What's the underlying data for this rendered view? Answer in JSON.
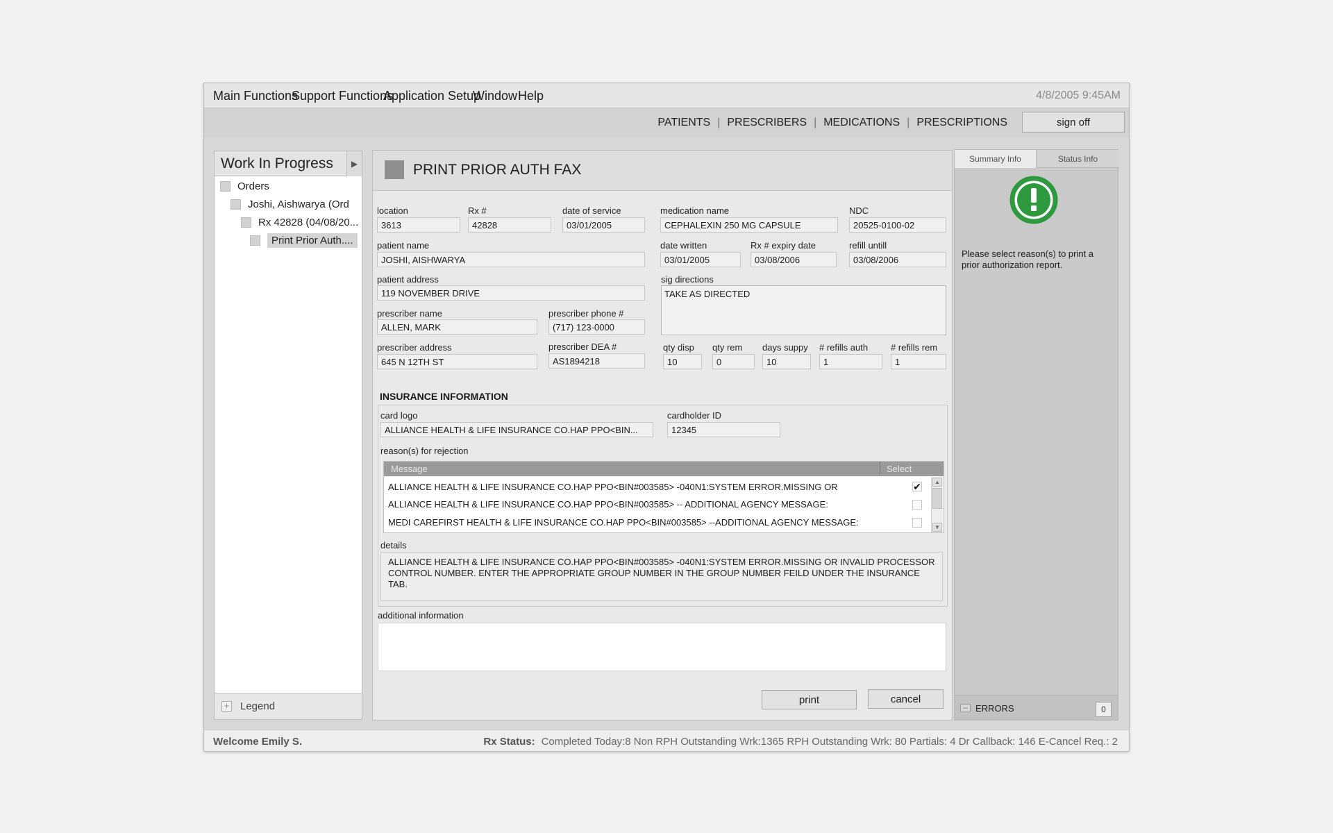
{
  "menubar": {
    "items": [
      "Main Functions",
      "Support Functions",
      "Application Setup",
      "Window",
      "Help"
    ],
    "datetime": "4/8/2005 9:45AM"
  },
  "navbar": {
    "links": [
      "PATIENTS",
      "PRESCRIBERS",
      "MEDICATIONS",
      "PRESCRIPTIONS"
    ],
    "signoff": "sign off"
  },
  "wip": {
    "title": "Work In Progress",
    "tree": [
      "Orders",
      "Joshi, Aishwarya (Ord",
      "Rx 42828 (04/08/20...",
      "Print Prior Auth...."
    ],
    "legend": "Legend"
  },
  "form": {
    "title": "PRINT PRIOR AUTH FAX",
    "location_label": "location",
    "location": "3613",
    "rx_label": "Rx #",
    "rx": "42828",
    "dos_label": "date of service",
    "dos": "03/01/2005",
    "med_label": "medication name",
    "med": "CEPHALEXIN 250 MG CAPSULE",
    "ndc_label": "NDC",
    "ndc": "20525-0100-02",
    "patient_name_label": "patient name",
    "patient_name": "JOSHI, AISHWARYA",
    "date_written_label": "date written",
    "date_written": "03/01/2005",
    "rx_expiry_label": "Rx # expiry date",
    "rx_expiry": "03/08/2006",
    "refill_until_label": "refill untill",
    "refill_until": "03/08/2006",
    "patient_address_label": "patient address",
    "patient_address": "119 NOVEMBER DRIVE",
    "sig_label": "sig directions",
    "sig": "TAKE AS DIRECTED",
    "prescriber_name_label": "prescriber name",
    "prescriber_name": "ALLEN, MARK",
    "prescriber_phone_label": "prescriber phone #",
    "prescriber_phone": "(717) 123-0000",
    "prescriber_address_label": "prescriber address",
    "prescriber_address": "645 N 12TH ST",
    "prescriber_dea_label": "prescriber DEA #",
    "prescriber_dea": "AS1894218",
    "qty_disp_label": "qty disp",
    "qty_disp": "10",
    "qty_rem_label": "qty rem",
    "qty_rem": "0",
    "days_supply_label": "days suppy",
    "days_supply": "10",
    "refills_auth_label": "# refills auth",
    "refills_auth": "1",
    "refills_rem_label": "# refills rem",
    "refills_rem": "1"
  },
  "insurance": {
    "section_title": "INSURANCE INFORMATION",
    "card_logo_label": "card logo",
    "card_logo": "ALLIANCE HEALTH & LIFE INSURANCE CO.HAP PPO<BIN...",
    "cardholder_label": "cardholder ID",
    "cardholder": "12345",
    "reasons_label": "reason(s) for rejection",
    "table_headers": [
      "Message",
      "Select"
    ],
    "rows": [
      {
        "message": "ALLIANCE HEALTH & LIFE INSURANCE CO.HAP PPO<BIN#003585> -040N1:SYSTEM ERROR.MISSING OR",
        "check": "✔"
      },
      {
        "message": "ALLIANCE HEALTH & LIFE INSURANCE CO.HAP PPO<BIN#003585> -- ADDITIONAL AGENCY MESSAGE:",
        "check": ""
      },
      {
        "message": "MEDI CAREFIRST HEALTH & LIFE INSURANCE CO.HAP PPO<BIN#003585>  --ADDITIONAL AGENCY MESSAGE:",
        "check": ""
      }
    ],
    "details_label": "details",
    "details": "ALLIANCE HEALTH & LIFE INSURANCE CO.HAP PPO<BIN#003585> -040N1:SYSTEM ERROR.MISSING OR INVALID PROCESSOR CONTROL NUMBER. ENTER THE APPROPRIATE GROUP NUMBER IN THE GROUP NUMBER FEILD UNDER THE INSURANCE TAB."
  },
  "additional": {
    "label": "additional information",
    "value": ""
  },
  "buttons": {
    "print": "print",
    "cancel": "cancel"
  },
  "right": {
    "tab_summary": "Summary Info",
    "tab_status": "Status Info",
    "icon": "alert-exclamation-icon",
    "icon_color": "#2e9a3e",
    "message": "Please select reason(s) to print a prior authorization report.",
    "errors_label": "ERRORS",
    "errors_count": "0"
  },
  "statusbar": {
    "welcome": "Welcome Emily S.",
    "rx_status_label": "Rx Status:",
    "rx_status": "Completed Today:8  Non RPH Outstanding Wrk:1365  RPH Outstanding Wrk: 80  Partials: 4  Dr Callback: 146  E-Cancel Req.: 2"
  }
}
